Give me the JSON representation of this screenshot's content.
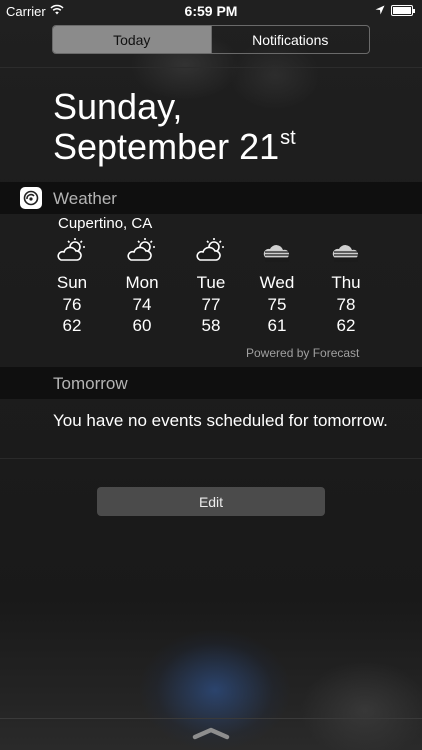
{
  "status_bar": {
    "carrier": "Carrier",
    "time": "6:59 PM",
    "icons": [
      "wifi-icon",
      "location-arrow-icon",
      "battery-icon"
    ]
  },
  "tabs": [
    {
      "label": "Today",
      "selected": true
    },
    {
      "label": "Notifications",
      "selected": false
    }
  ],
  "date": {
    "line1": "Sunday,",
    "line2": "September 21",
    "suffix": "st"
  },
  "weather": {
    "section_title": "Weather",
    "app_icon": "forecast-app-icon",
    "location": "Cupertino, CA",
    "days": [
      {
        "name": "Sun",
        "high": "76",
        "low": "62",
        "icon": "partly-sunny-icon"
      },
      {
        "name": "Mon",
        "high": "74",
        "low": "60",
        "icon": "partly-sunny-icon"
      },
      {
        "name": "Tue",
        "high": "77",
        "low": "58",
        "icon": "partly-sunny-icon"
      },
      {
        "name": "Wed",
        "high": "75",
        "low": "61",
        "icon": "fog-icon"
      },
      {
        "name": "Thu",
        "high": "78",
        "low": "62",
        "icon": "fog-icon"
      }
    ],
    "powered_by": "Powered by Forecast"
  },
  "tomorrow": {
    "section_title": "Tomorrow",
    "message": "You have no events scheduled for tomorrow."
  },
  "edit_label": "Edit",
  "colors": {
    "background": "#1b1b1b",
    "section_header": "#0f0f0f",
    "segment_selected": "#8b8b8b",
    "button": "#4b4b4b",
    "muted_text": "#b4b4b4"
  }
}
